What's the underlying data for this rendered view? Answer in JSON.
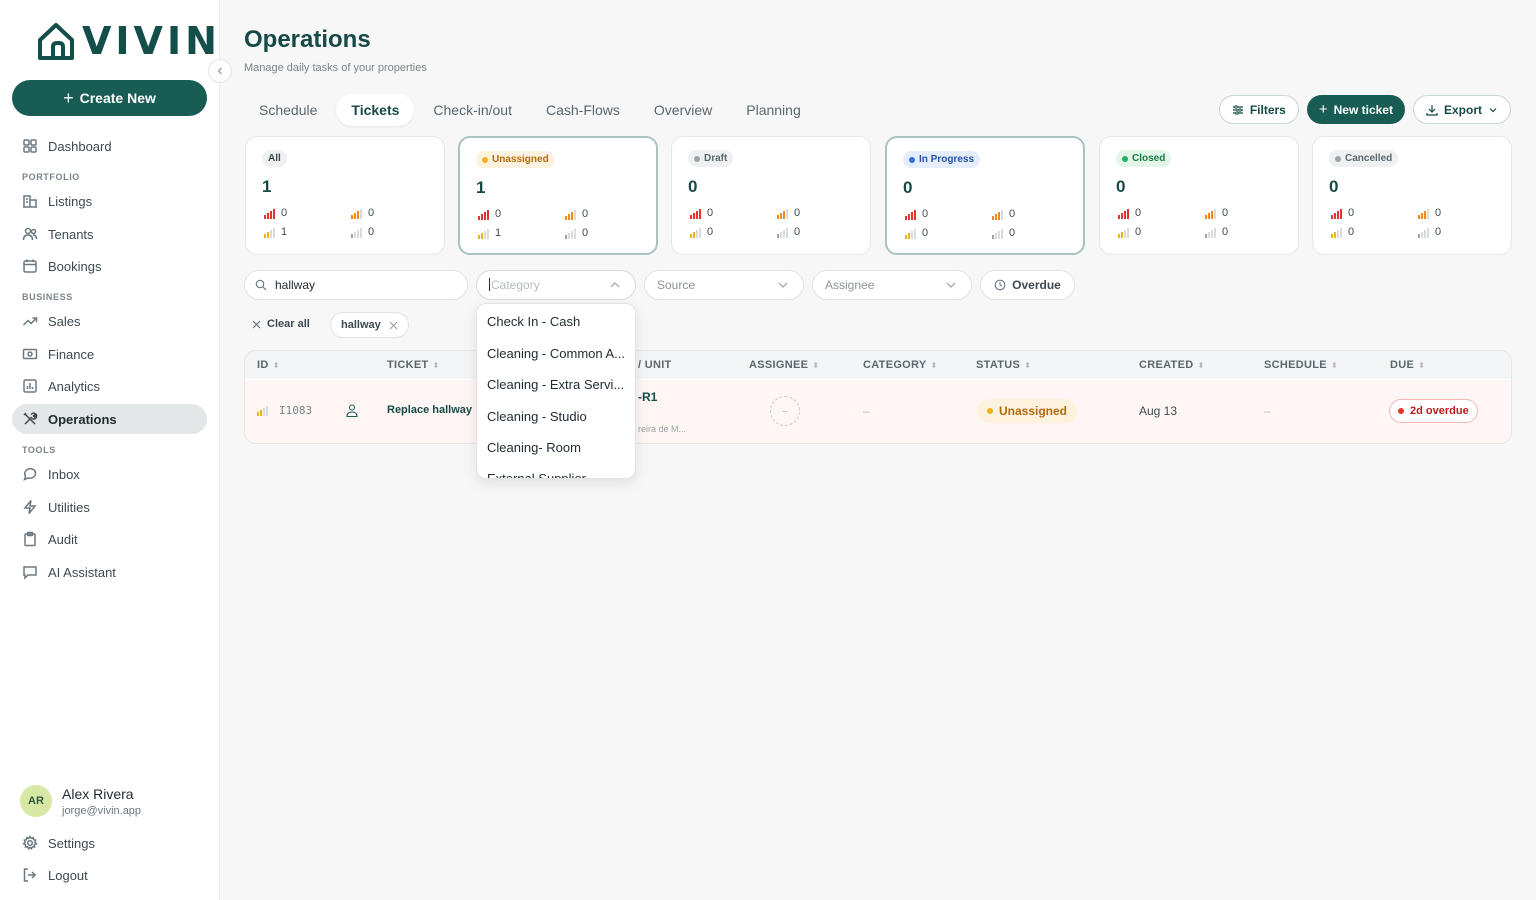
{
  "app": {
    "logo_text": "VIVIN"
  },
  "sidebar": {
    "create_label": "Create New",
    "dashboard": "Dashboard",
    "sections": {
      "portfolio": "PORTFOLIO",
      "business": "BUSINESS",
      "tools": "TOOLS"
    },
    "items": {
      "listings": "Listings",
      "tenants": "Tenants",
      "bookings": "Bookings",
      "sales": "Sales",
      "finance": "Finance",
      "analytics": "Analytics",
      "operations": "Operations",
      "inbox": "Inbox",
      "utilities": "Utilities",
      "audit": "Audit",
      "ai_assistant": "AI Assistant"
    },
    "user": {
      "initials": "AR",
      "name": "Alex Rivera",
      "email": "jorge@vivin.app"
    },
    "settings": "Settings",
    "logout": "Logout"
  },
  "header": {
    "title": "Operations",
    "subtitle": "Manage daily tasks of your properties",
    "tabs": [
      "Schedule",
      "Tickets",
      "Check-in/out",
      "Cash-Flows",
      "Overview",
      "Planning"
    ],
    "active_tab": "Tickets",
    "filters_label": "Filters",
    "new_ticket_label": "New ticket",
    "export_label": "Export"
  },
  "stats": [
    {
      "label": "All",
      "count": "1",
      "p": [
        "0",
        "0",
        "1",
        "0"
      ]
    },
    {
      "label": "Unassigned",
      "count": "1",
      "p": [
        "0",
        "0",
        "1",
        "0"
      ]
    },
    {
      "label": "Draft",
      "count": "0",
      "p": [
        "0",
        "0",
        "0",
        "0"
      ]
    },
    {
      "label": "In Progress",
      "count": "0",
      "p": [
        "0",
        "0",
        "0",
        "0"
      ]
    },
    {
      "label": "Closed",
      "count": "0",
      "p": [
        "0",
        "0",
        "0",
        "0"
      ]
    },
    {
      "label": "Cancelled",
      "count": "0",
      "p": [
        "0",
        "0",
        "0",
        "0"
      ]
    }
  ],
  "colors": {
    "unassigned": "#f0b11a",
    "draft": "#9aa3a7",
    "in_progress": "#2f6fd6",
    "closed": "#22b35e",
    "cancelled": "#9aa3a7",
    "accent": "#185c54"
  },
  "filters": {
    "search_value": "hallway",
    "category_placeholder": "Category",
    "source_placeholder": "Source",
    "assignee_placeholder": "Assignee",
    "overdue_label": "Overdue",
    "clear_all_label": "Clear all",
    "chip_label": "hallway"
  },
  "category_options": [
    "Check In - Cash",
    "Cleaning - Common A...",
    "Cleaning - Extra Servi...",
    "Cleaning - Studio",
    "Cleaning- Room",
    "External Supplier"
  ],
  "table": {
    "columns": [
      "ID",
      "TICKET",
      "/ UNIT",
      "ASSIGNEE",
      "CATEGORY",
      "STATUS",
      "CREATED",
      "SCHEDULE",
      "DUE"
    ],
    "rows": [
      {
        "id": "I1083",
        "ticket": "Replace hallway",
        "unit": "-R1",
        "unit_sub": "reira de M...",
        "assignee": "–",
        "category": "–",
        "status": "Unassigned",
        "created": "Aug 13",
        "schedule": "–",
        "due": "2d overdue"
      }
    ]
  }
}
